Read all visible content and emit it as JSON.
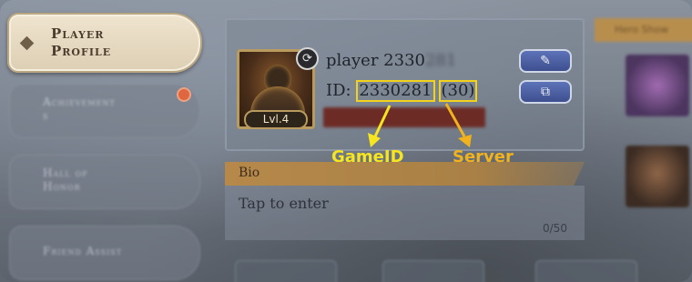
{
  "nav": {
    "active_label_line1": "Player",
    "active_label_line2": "Profile",
    "items": [
      {
        "label_line1": "Achievement",
        "label_line2": "s"
      },
      {
        "label_line1": "Hall of",
        "label_line2": "Honor"
      },
      {
        "label_line1": "Friend Assist",
        "label_line2": ""
      }
    ]
  },
  "profile": {
    "name_visible": "player 2330",
    "name_hidden": "281",
    "id_prefix": "ID: ",
    "game_id": "2330281",
    "server": "(30)",
    "level": "Lvl.4",
    "refresh_icon_glyph": "⟳",
    "edit_button_glyph": "✎",
    "copy_button_glyph": "⧉"
  },
  "annotations": {
    "gameid_label": "GameID",
    "server_label": "Server",
    "box_color": "#f2d21c",
    "gameid_color": "#f7e51f",
    "server_color": "#f2b21c"
  },
  "bio": {
    "header": "Bio",
    "placeholder": "Tap to enter",
    "count": "0/50"
  },
  "right_panel": {
    "tab_label": "Hero Show"
  }
}
